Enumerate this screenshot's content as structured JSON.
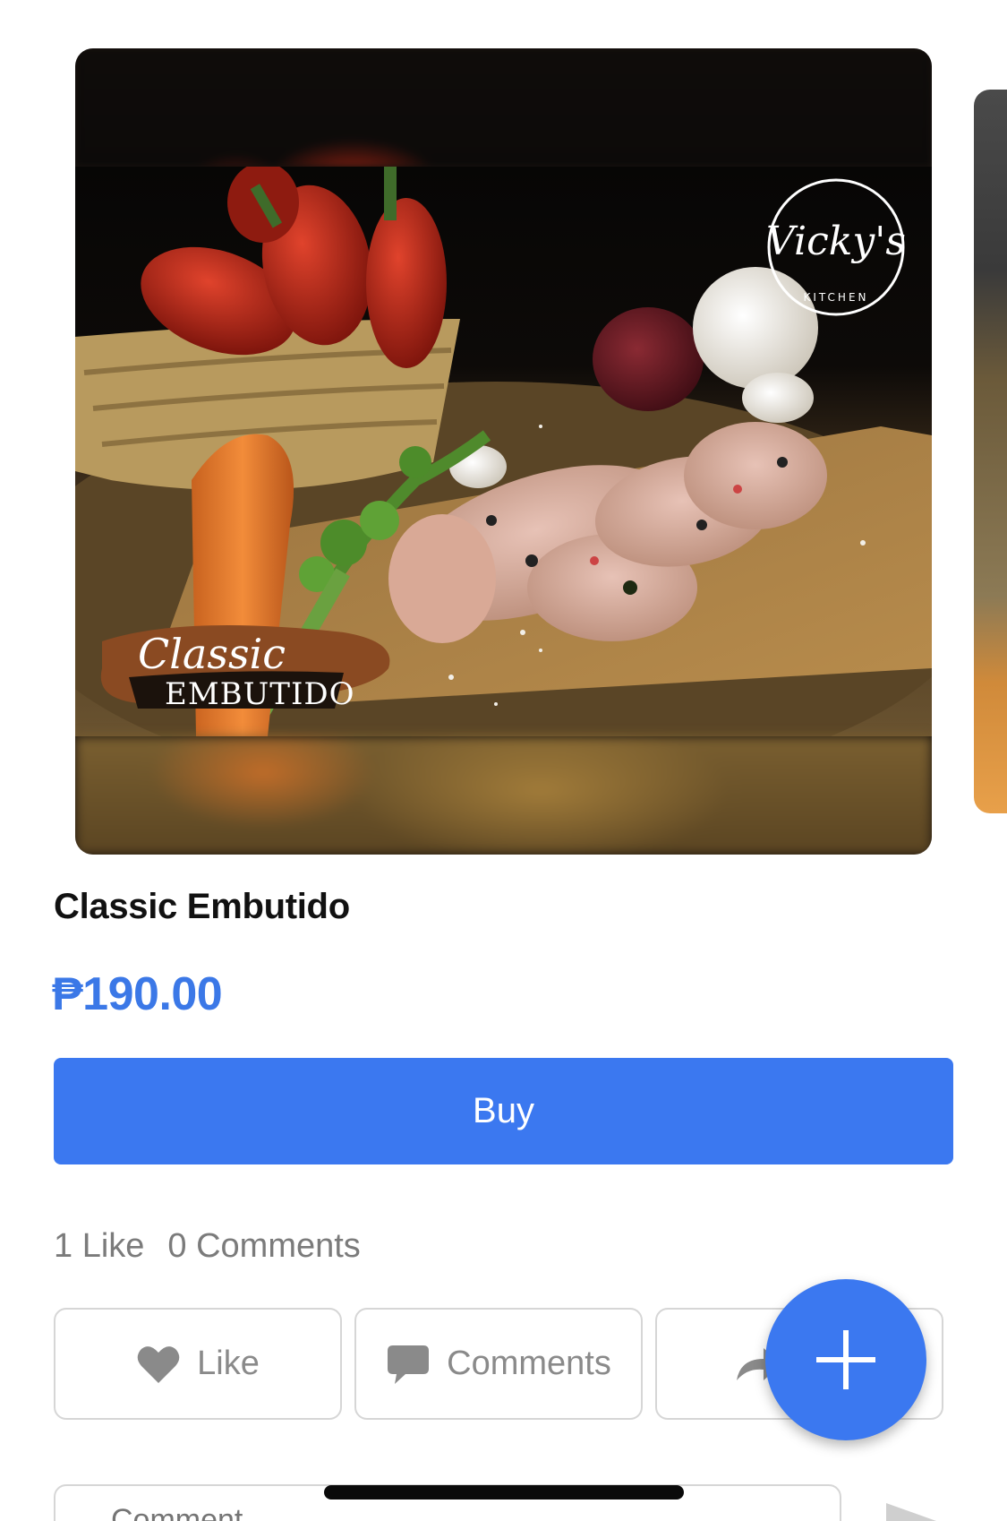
{
  "carousel": {
    "image_alt": "Classic Embutido",
    "brand_logo_text": "Vicky's",
    "brand_logo_subtext": "KITCHEN",
    "overlay_script_text": "Classic",
    "overlay_block_text": "EMBUTIDO"
  },
  "product": {
    "title": "Classic Embutido",
    "price": "₱190.00",
    "buy_label": "Buy"
  },
  "stats": {
    "likes": "1 Like",
    "comments": "0 Comments"
  },
  "actions": {
    "like_label": "Like",
    "comments_label": "Comments",
    "share_icon": "share-arrow-icon"
  },
  "fab": {
    "icon": "plus-icon"
  },
  "comment_box": {
    "placeholder": "Comment..."
  },
  "colors": {
    "accent": "#3b78f0",
    "price": "#3b78e7",
    "muted": "#7b7b7b",
    "border": "#d6d6d6"
  }
}
